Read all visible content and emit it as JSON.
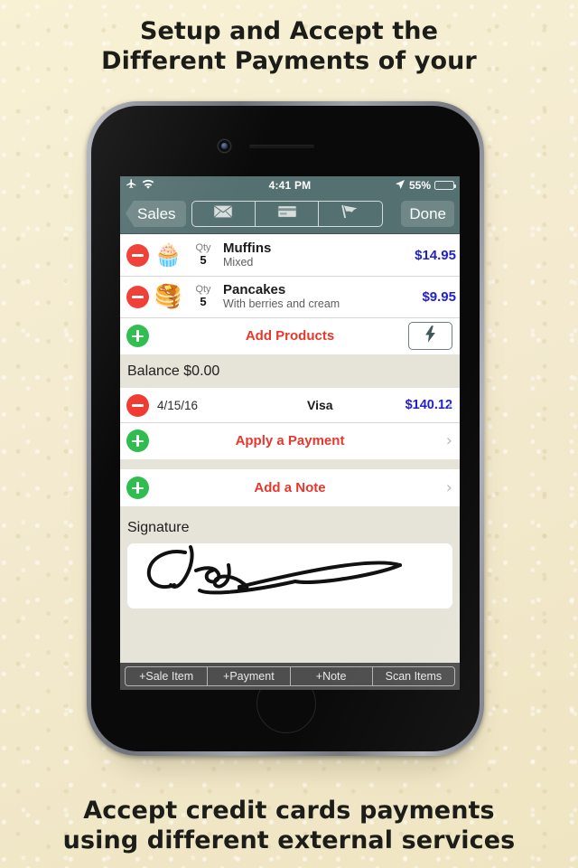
{
  "captions": {
    "top": [
      "Setup and Accept the",
      "Different Payments of your"
    ],
    "bottom": [
      "Accept credit cards payments",
      "using different external services"
    ]
  },
  "colors": {
    "background": "#f6eecb",
    "nav_bar": "#557071",
    "accent_red": "#e8372c",
    "accent_green": "#2ebd4e",
    "accent_price": "#2222cc",
    "section_bg": "#e6e3d8",
    "toolbar_bg": "#4e4e4e"
  },
  "status_bar": {
    "airplane_icon": "airplane-icon",
    "wifi_icon": "wifi-icon",
    "time": "4:41 PM",
    "location_icon": "location-arrow-icon",
    "battery_percent": "55%",
    "battery_level": 55
  },
  "nav_bar": {
    "back_label": "Sales",
    "done_label": "Done",
    "segments": [
      {
        "name": "email",
        "icon": "envelope-icon"
      },
      {
        "name": "card",
        "icon": "credit-card-icon"
      },
      {
        "name": "flag",
        "icon": "flag-icon"
      }
    ]
  },
  "line_items": [
    {
      "thumb": "🧁",
      "thumb_icon": "muffin-image",
      "qty_label": "Qty",
      "qty": "5",
      "title": "Muffins",
      "subtitle": "Mixed",
      "price": "$14.95"
    },
    {
      "thumb": "🥞",
      "thumb_icon": "pancake-image",
      "qty_label": "Qty",
      "qty": "5",
      "title": "Pancakes",
      "subtitle": "With berries and cream",
      "price": "$9.95"
    }
  ],
  "add_products": {
    "label": "Add Products",
    "bolt_icon": "lightning-bolt-icon"
  },
  "balance": {
    "label": "Balance $0.00"
  },
  "payments": [
    {
      "date": "4/15/16",
      "type": "Visa",
      "amount": "$140.12"
    }
  ],
  "apply_payment": {
    "label": "Apply a Payment"
  },
  "add_note": {
    "label": "Add a Note"
  },
  "signature": {
    "header": "Signature",
    "has_signature": true
  },
  "toolbar": {
    "buttons": [
      {
        "label": "+Sale Item"
      },
      {
        "label": "+Payment"
      },
      {
        "label": "+Note"
      },
      {
        "label": "Scan Items"
      }
    ]
  }
}
